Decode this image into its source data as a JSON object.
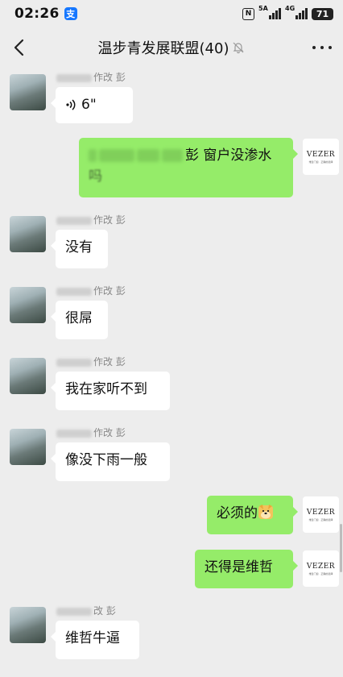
{
  "status": {
    "time": "02:26",
    "alipay_glyph": "支",
    "nfc": "N",
    "sig1_tag": "5A",
    "sig2_tag": "4G",
    "battery": "71"
  },
  "header": {
    "title": "温步青发展联盟(40)"
  },
  "brand": {
    "name": "VEZER",
    "sub": "维哲门窗 · 正确的选择"
  },
  "messages": {
    "m1": {
      "nick_suffix": "作改 彭",
      "voice_length": "6\""
    },
    "m2": {
      "text_visible": "彭 窗户没渗水",
      "text_line2": "吗"
    },
    "m3": {
      "nick_suffix": "作改 彭",
      "text": "没有"
    },
    "m4": {
      "nick_suffix": "作改 彭",
      "text": "很屌"
    },
    "m5": {
      "nick_suffix": "作改 彭",
      "text": "我在家听不到"
    },
    "m6": {
      "nick_suffix": "作改 彭",
      "text": "像没下雨一般"
    },
    "m7": {
      "text": "必须的",
      "emoji": "doge-emoji"
    },
    "m8": {
      "text": "还得是维哲"
    },
    "m9": {
      "nick_suffix": "改 彭",
      "text": "维哲牛逼"
    }
  },
  "icons": [
    "back-arrow-icon",
    "mute-bell-icon",
    "more-dots-icon",
    "voice-wave-icon"
  ],
  "colors": {
    "background": "#ededed",
    "outgoing_bubble": "#95ec69",
    "incoming_bubble": "#ffffff",
    "nickname": "#888888"
  }
}
